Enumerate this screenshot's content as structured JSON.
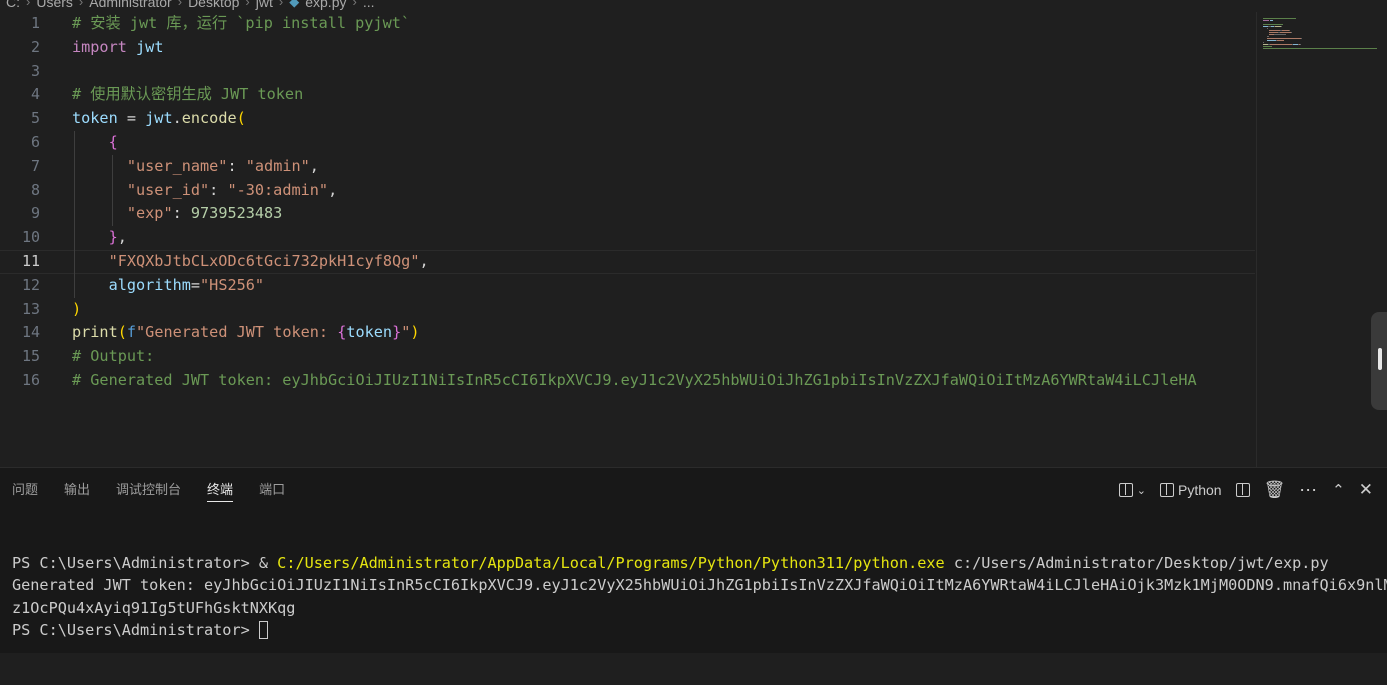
{
  "breadcrumb": {
    "items": [
      "C:",
      "Users",
      "Administrator",
      "Desktop",
      "jwt",
      "exp.py",
      "..."
    ],
    "file_icon": "python-file-icon"
  },
  "editor": {
    "lines": [
      {
        "n": "1",
        "tokens": [
          [
            "c-com",
            "# 安装 jwt 库，运行 `pip install pyjwt`"
          ]
        ]
      },
      {
        "n": "2",
        "tokens": [
          [
            "c-kw",
            "import"
          ],
          [
            "c-def",
            " "
          ],
          [
            "c-var",
            "jwt"
          ]
        ]
      },
      {
        "n": "3",
        "tokens": []
      },
      {
        "n": "4",
        "tokens": [
          [
            "c-com",
            "# 使用默认密钥生成 JWT token"
          ]
        ]
      },
      {
        "n": "5",
        "tokens": [
          [
            "c-var",
            "token"
          ],
          [
            "c-def",
            " = "
          ],
          [
            "c-var",
            "jwt"
          ],
          [
            "c-def",
            "."
          ],
          [
            "c-fn",
            "encode"
          ],
          [
            "c-b1",
            "("
          ]
        ]
      },
      {
        "n": "6",
        "tokens": [
          [
            "c-def",
            "    "
          ],
          [
            "c-b2",
            "{"
          ]
        ]
      },
      {
        "n": "7",
        "tokens": [
          [
            "c-def",
            "      "
          ],
          [
            "c-str",
            "\"user_name\""
          ],
          [
            "c-def",
            ": "
          ],
          [
            "c-str",
            "\"admin\""
          ],
          [
            "c-def",
            ","
          ]
        ]
      },
      {
        "n": "8",
        "tokens": [
          [
            "c-def",
            "      "
          ],
          [
            "c-str",
            "\"user_id\""
          ],
          [
            "c-def",
            ": "
          ],
          [
            "c-str",
            "\"-30:admin\""
          ],
          [
            "c-def",
            ","
          ]
        ]
      },
      {
        "n": "9",
        "tokens": [
          [
            "c-def",
            "      "
          ],
          [
            "c-str",
            "\"exp\""
          ],
          [
            "c-def",
            ": "
          ],
          [
            "c-num",
            "9739523483"
          ]
        ]
      },
      {
        "n": "10",
        "tokens": [
          [
            "c-def",
            "    "
          ],
          [
            "c-b2",
            "}"
          ],
          [
            "c-def",
            ","
          ]
        ]
      },
      {
        "n": "11",
        "tokens": [
          [
            "c-def",
            "    "
          ],
          [
            "c-str",
            "\"FXQXbJtbCLxODc6tGci732pkH1cyf8Qg\""
          ],
          [
            "c-def",
            ","
          ]
        ]
      },
      {
        "n": "12",
        "tokens": [
          [
            "c-def",
            "    "
          ],
          [
            "c-var",
            "algorithm"
          ],
          [
            "c-def",
            "="
          ],
          [
            "c-str",
            "\"HS256\""
          ]
        ]
      },
      {
        "n": "13",
        "tokens": [
          [
            "c-b1",
            ")"
          ]
        ]
      },
      {
        "n": "14",
        "tokens": [
          [
            "c-fn",
            "print"
          ],
          [
            "c-b1",
            "("
          ],
          [
            "c-blue",
            "f"
          ],
          [
            "c-str",
            "\"Generated JWT token: "
          ],
          [
            "c-b2",
            "{"
          ],
          [
            "c-var",
            "token"
          ],
          [
            "c-b2",
            "}"
          ],
          [
            "c-str",
            "\""
          ],
          [
            "c-b1",
            ")"
          ]
        ]
      },
      {
        "n": "15",
        "tokens": [
          [
            "c-com",
            "# Output:"
          ]
        ]
      },
      {
        "n": "16",
        "tokens": [
          [
            "c-com",
            "# Generated JWT token: eyJhbGciOiJIUzI1NiIsInR5cCI6IkpXVCJ9.eyJ1c2VyX25hbWUiOiJhZG1pbiIsInVzZXJfaWQiOiItMzA6YWRtaW4iLCJleHA"
          ]
        ]
      }
    ],
    "active_line": "11"
  },
  "panel": {
    "tabs": [
      {
        "label": "问题",
        "name": "tab-problems"
      },
      {
        "label": "输出",
        "name": "tab-output"
      },
      {
        "label": "调试控制台",
        "name": "tab-debug-console"
      },
      {
        "label": "终端",
        "name": "tab-terminal",
        "active": true
      },
      {
        "label": "端口",
        "name": "tab-ports"
      }
    ],
    "terminal_profile": "Python",
    "icons": [
      "split-terminal-icon",
      "chevron-down-icon",
      "terminal-split-icon",
      "split-editor-icon",
      "trash-icon",
      "more-icon",
      "maximize-panel-icon",
      "close-icon"
    ]
  },
  "terminal": {
    "line1_prompt": "PS C:\\Users\\Administrator> & ",
    "line1_exe": "C:/Users/Administrator/AppData/Local/Programs/Python/Python311/python.exe",
    "line1_arg": " c:/Users/Administrator/Desktop/jwt/exp.py",
    "line2": "Generated JWT token: eyJhbGciOiJIUzI1NiIsInR5cCI6IkpXVCJ9.eyJ1c2VyX25hbWUiOiJhZG1pbiIsInVzZXJfaWQiOiItMzA6YWRtaW4iLCJleHAiOjk3Mzk1MjM0ODN9.mnafQi6x9nlM",
    "line3": "z1OcPQu4xAyiq91Ig5tUFhGsktNXKqg",
    "line4_prompt": "PS C:\\Users\\Administrator> "
  },
  "colors": {
    "background": "#1f1f1f",
    "panel": "#181818",
    "comment": "#6a9955",
    "string": "#ce9178",
    "variable": "#9cdcfe",
    "keyword": "#c586c0",
    "function": "#dcdcaa",
    "terminal_exe": "#e5e510"
  }
}
